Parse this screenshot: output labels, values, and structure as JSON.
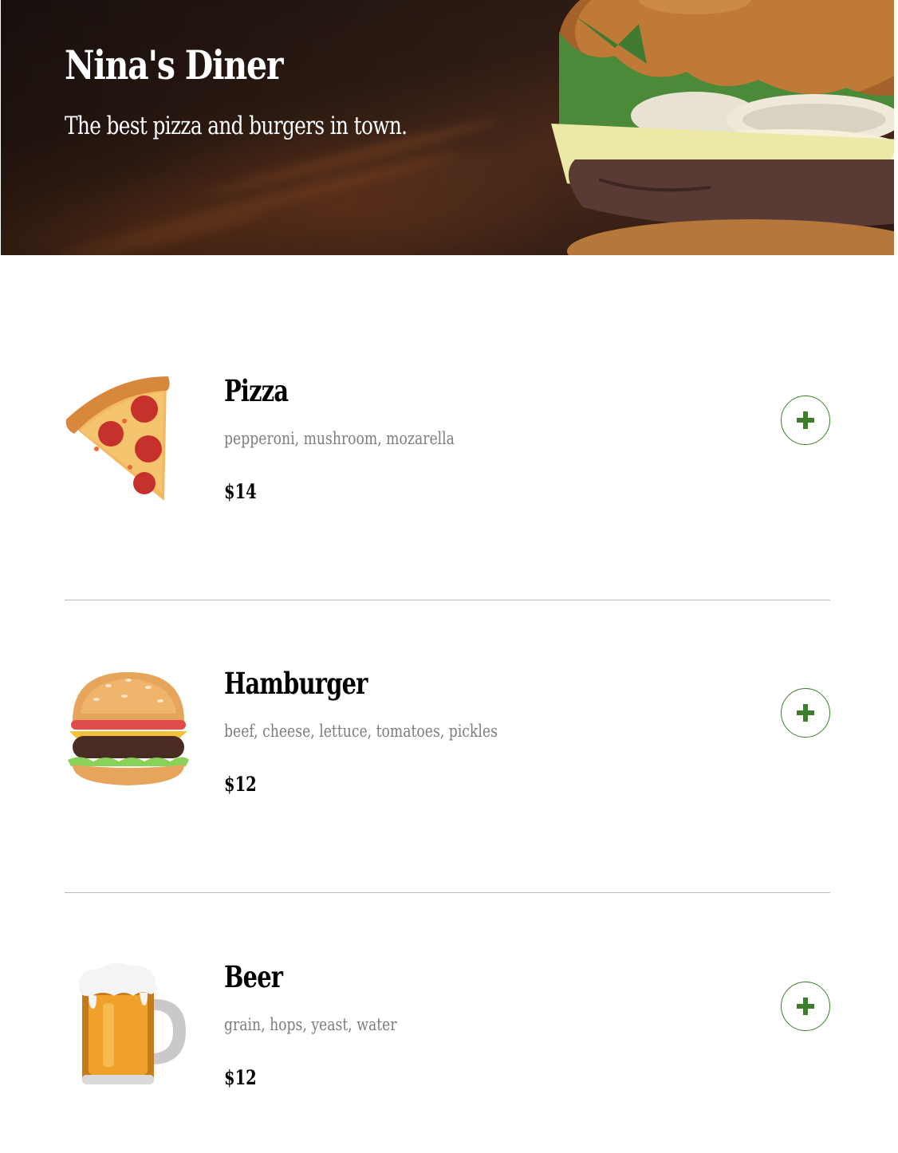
{
  "header": {
    "title": "Nina's Diner",
    "tagline": "The best pizza and burgers in town."
  },
  "menu": {
    "items": [
      {
        "name": "Pizza",
        "ingredients": "pepperoni, mushroom, mozarella",
        "price": "$14",
        "emoji": "pizza-slice-icon"
      },
      {
        "name": "Hamburger",
        "ingredients": "beef, cheese, lettuce, tomatoes, pickles",
        "price": "$12",
        "emoji": "hamburger-icon"
      },
      {
        "name": "Beer",
        "ingredients": "grain, hops, yeast, water",
        "price": "$12",
        "emoji": "beer-mug-icon"
      }
    ],
    "add_button_icon": "plus-icon"
  },
  "colors": {
    "accent_green": "#3e7e2a",
    "description_gray": "#7d7d7d",
    "divider": "#bdbdbd"
  }
}
